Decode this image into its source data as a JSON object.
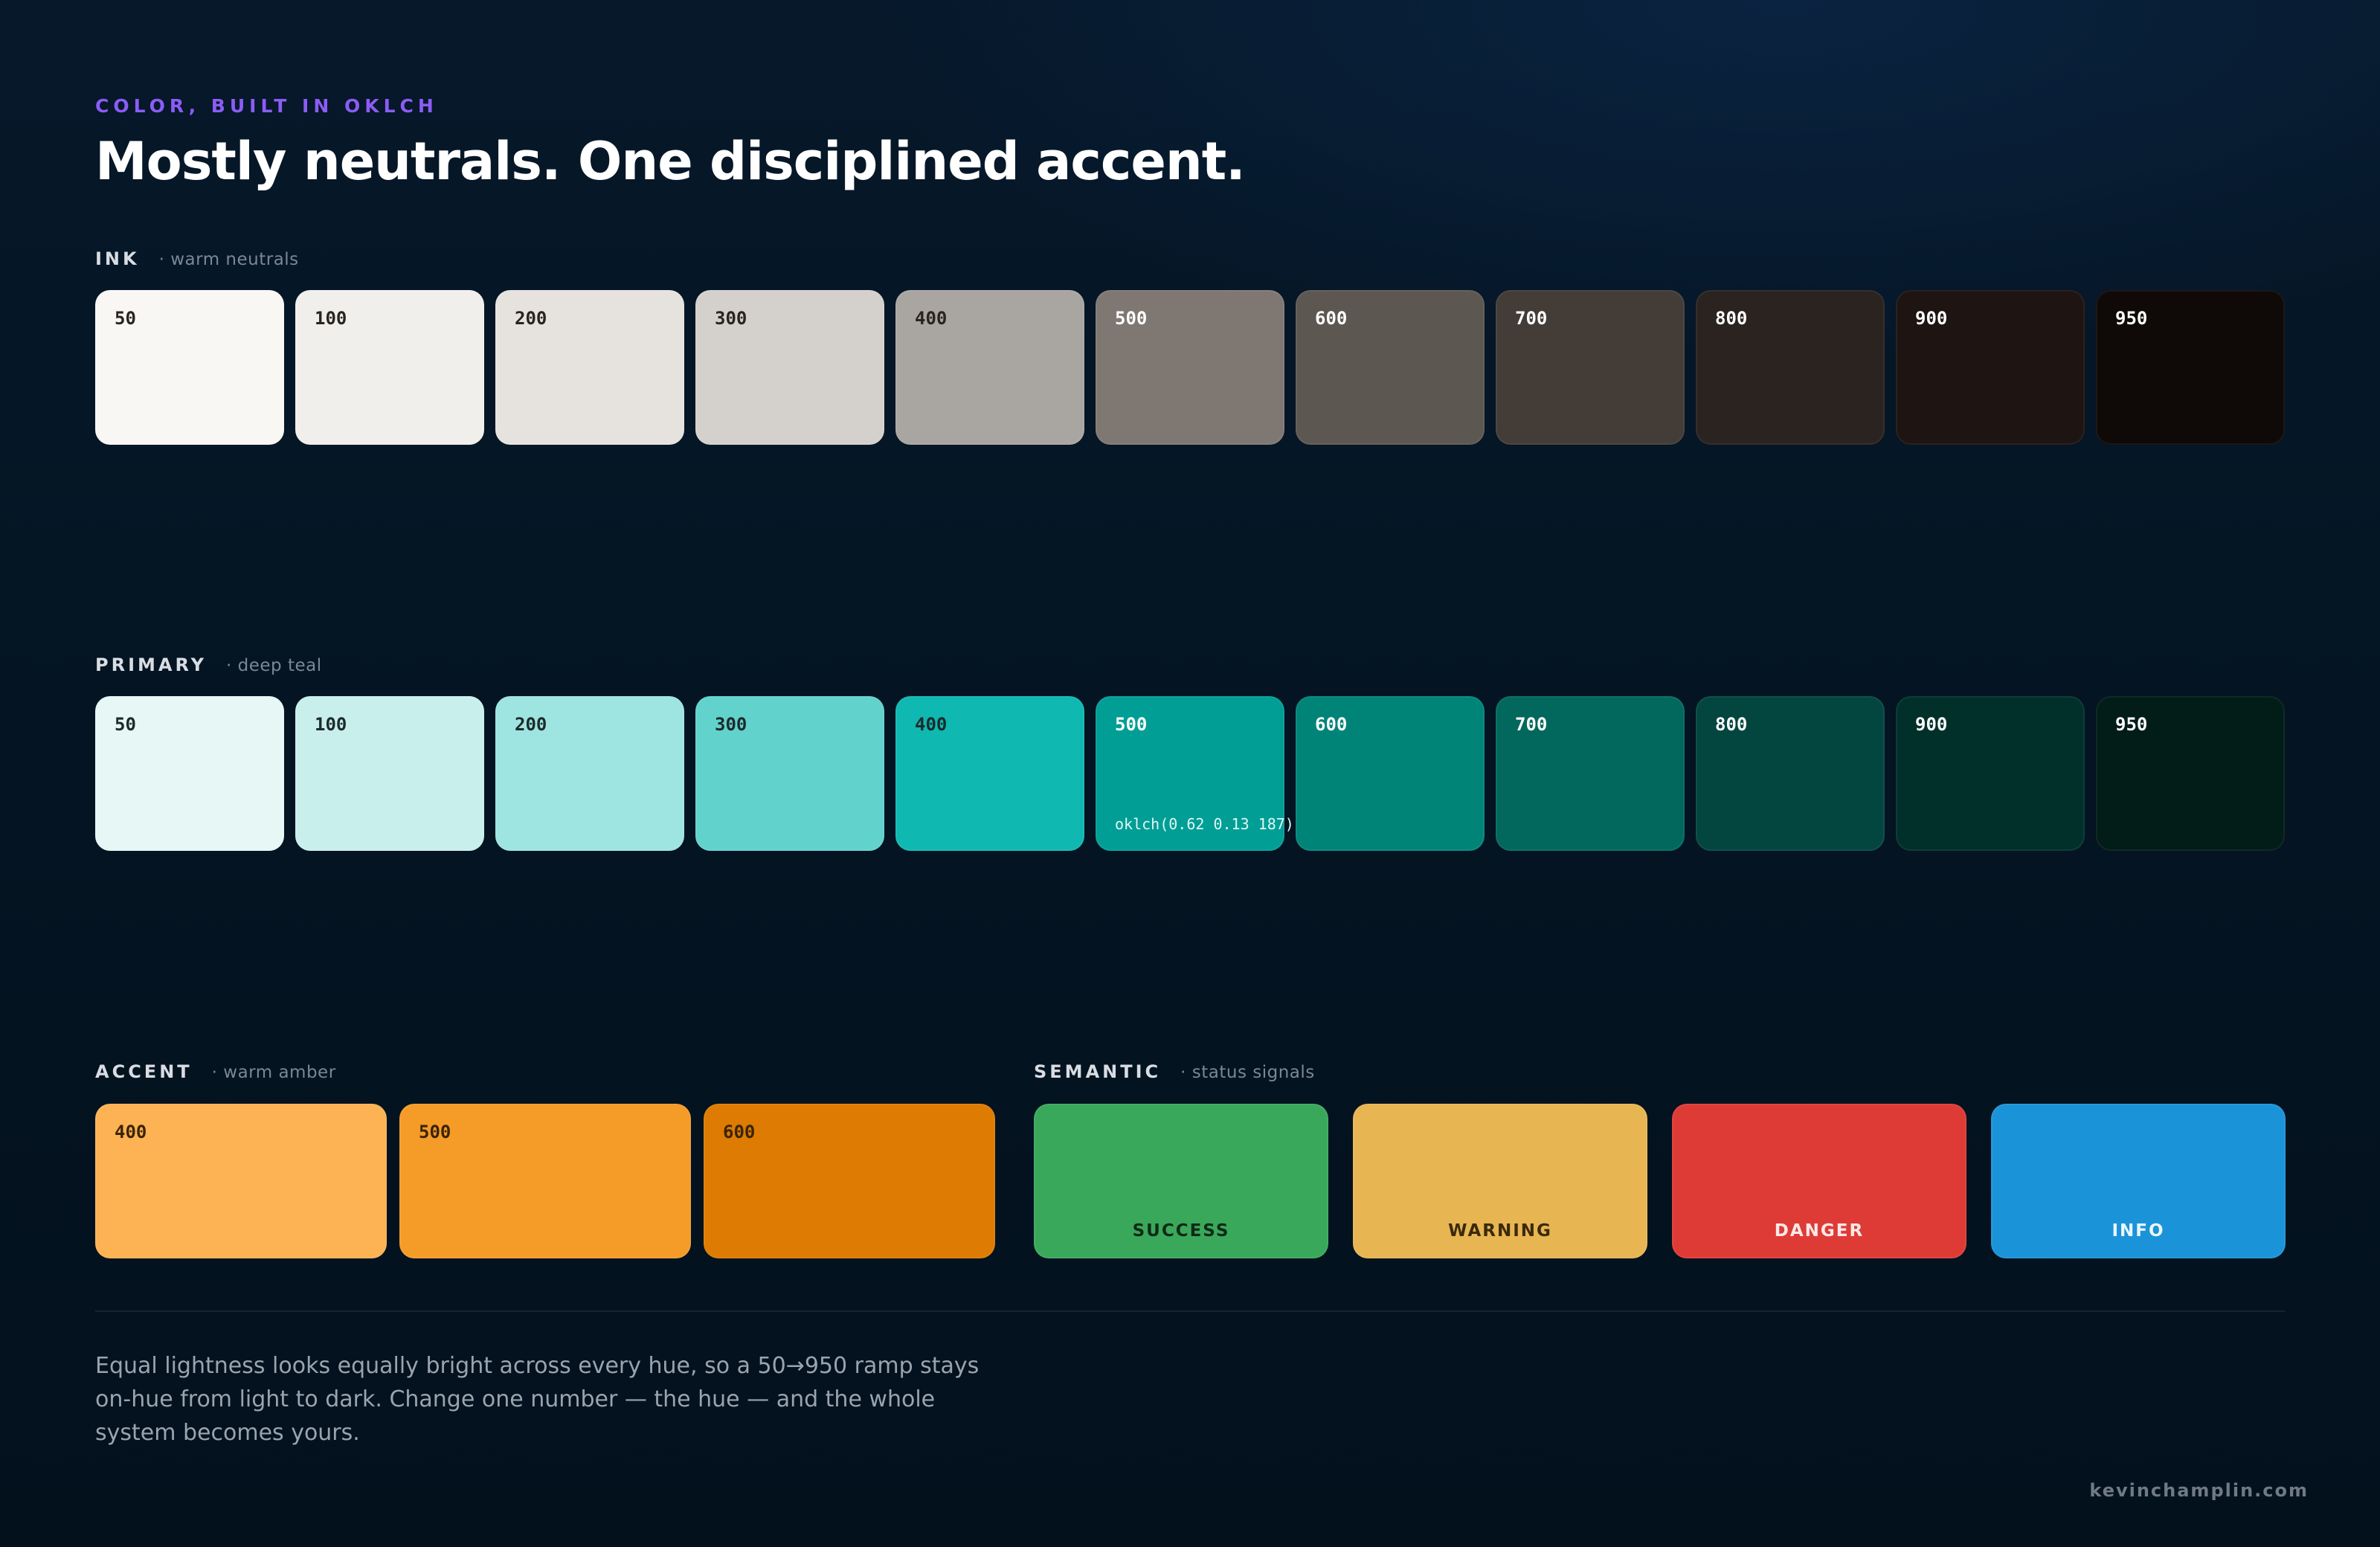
{
  "header": {
    "eyebrow": "COLOR, BUILT IN OKLCH",
    "headline": "Mostly neutrals. One disciplined accent."
  },
  "ink": {
    "name": "INK",
    "desc": "· warm neutrals",
    "swatches": [
      {
        "step": "50",
        "color": "#f9f7f4",
        "text": "#2a2420"
      },
      {
        "step": "100",
        "color": "#f1efeb",
        "text": "#2a2420"
      },
      {
        "step": "200",
        "color": "#e6e3df",
        "text": "#2a2420"
      },
      {
        "step": "300",
        "color": "#d4d1cd",
        "text": "#2a2420"
      },
      {
        "step": "400",
        "color": "#a9a5a0",
        "text": "#2a2420"
      },
      {
        "step": "500",
        "color": "#7f7772",
        "text": "#ffffff"
      },
      {
        "step": "600",
        "color": "#5d5752",
        "text": "#ffffff"
      },
      {
        "step": "700",
        "color": "#433c37",
        "text": "#ffffff"
      },
      {
        "step": "800",
        "color": "#2a231f",
        "text": "#ffffff"
      },
      {
        "step": "900",
        "color": "#1e1412",
        "text": "#ffffff"
      },
      {
        "step": "950",
        "color": "#0f0a07",
        "text": "#ffffff"
      }
    ]
  },
  "primary": {
    "name": "PRIMARY",
    "desc": "· deep teal",
    "swatches": [
      {
        "step": "50",
        "color": "#e7f7f5",
        "text": "#1c2b2a"
      },
      {
        "step": "100",
        "color": "#c9efed",
        "text": "#1c2b2a"
      },
      {
        "step": "200",
        "color": "#9ee4e0",
        "text": "#1c2b2a"
      },
      {
        "step": "300",
        "color": "#62d2cc",
        "text": "#1c2b2a"
      },
      {
        "step": "400",
        "color": "#0fb8b0",
        "text": "#1c2b2a"
      },
      {
        "step": "500",
        "color": "#009e95",
        "text": "#ffffff",
        "code": "oklch(0.62 0.13 187)"
      },
      {
        "step": "600",
        "color": "#008478",
        "text": "#ffffff"
      },
      {
        "step": "700",
        "color": "#02685d",
        "text": "#ffffff"
      },
      {
        "step": "800",
        "color": "#03463f",
        "text": "#ffffff"
      },
      {
        "step": "900",
        "color": "#01302b",
        "text": "#ffffff"
      },
      {
        "step": "950",
        "color": "#021c18",
        "text": "#ffffff"
      }
    ]
  },
  "accent": {
    "name": "ACCENT",
    "desc": "· warm amber",
    "swatches": [
      {
        "step": "400",
        "color": "#fdb253",
        "text": "#3a2406"
      },
      {
        "step": "500",
        "color": "#f49b28",
        "text": "#3a2406"
      },
      {
        "step": "600",
        "color": "#dd7b02",
        "text": "#3a2406"
      }
    ]
  },
  "semantic": {
    "name": "SEMANTIC",
    "desc": "· status signals",
    "swatches": [
      {
        "label": "SUCCESS",
        "color": "#3aa85b",
        "text": "#0f2a16"
      },
      {
        "label": "WARNING",
        "color": "#e7b552",
        "text": "#3a2a0a"
      },
      {
        "label": "DANGER",
        "color": "#de3b37",
        "text": "#fbe9e8"
      },
      {
        "label": "INFO",
        "color": "#1b93d8",
        "text": "#eaf6fd"
      }
    ]
  },
  "body": {
    "text": "Equal lightness looks equally bright across every hue, so a 50→950 ramp stays on-hue from light to dark. Change one number — the hue — and the whole system becomes yours."
  },
  "footer": {
    "credit": "kevinchamplin.com"
  }
}
